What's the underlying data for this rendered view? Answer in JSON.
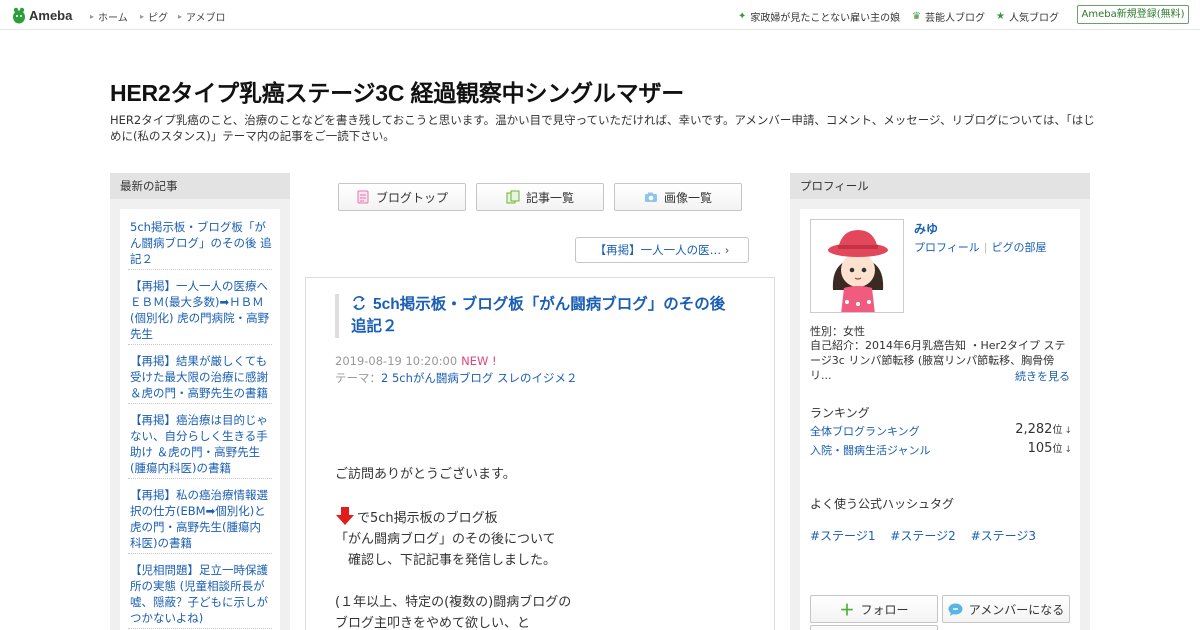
{
  "topbar": {
    "logo_text": "Ameba",
    "nav": [
      "ホーム",
      "ピグ",
      "アメブロ"
    ],
    "right_links": [
      "家政婦が見たことない雇い主の娘",
      "芸能人ブログ",
      "人気ブログ"
    ],
    "register_label": "Ameba新規登録(無料)",
    "accent": "#2c7a2c"
  },
  "blog": {
    "title": "HER2タイプ乳癌ステージ3C 経過観察中シングルマザー",
    "description": "HER2タイプ乳癌のこと、治療のことなどを書き残しておこうと思います。温かい目で見守っていただければ、幸いです。アメンバー申請、コメント、メッセージ、リブログについては、「はじめに(私のスタンス)」テーマ内の記事をご一読下さい。"
  },
  "left": {
    "heading": "最新の記事",
    "items": [
      "5ch掲示板・ブログ板「がん闘病ブログ」のその後 追記２",
      "【再掲】一人一人の医療へ ＥＢＭ(最大多数)➡ＨＢＭ(個別化) 虎の門病院・高野先生",
      "【再掲】結果が厳しくても受けた最大限の治療に感謝 ＆虎の門・高野先生の書籍",
      "【再掲】癌治療は目的じゃない、自分らしく生きる手助け ＆虎の門・高野先生(腫瘍内科医)の書籍",
      "【再掲】私の癌治療情報選択の仕方(EBM➡個別化)と虎の門・高野先生(腫瘍内科医)の書籍",
      "【児相問題】足立一時保護所の実態 (児童相談所長が嘘、隠蔽？子どもに示しがつかないよね)"
    ]
  },
  "center": {
    "buttons": [
      "ブログトップ",
      "記事一覧",
      "画像一覧"
    ],
    "prev_post": "【再掲】一人一人の医…",
    "article": {
      "title": "5ch掲示板・ブログ板「がん闘病ブログ」のその後 追記２",
      "date": "2019-08-19 10:20:00",
      "new_label": "NEW !",
      "theme_label": "テーマ：",
      "theme": "2 5chがん闘病ブログ スレのイジメ２",
      "body": {
        "line1": "ご訪問ありがとうございます。",
        "line2": "で5ch掲示板のブログ板",
        "line3": "「がん闘病ブログ」のその後について",
        "line4": "　確認し、下記記事を発信しました。",
        "line5": "(１年以上、特定の(複数の)闘病ブログの",
        "line6": "ブログ主叩きをやめて欲しい、と"
      }
    }
  },
  "right": {
    "heading": "プロフィール",
    "name": "みゆ",
    "links": [
      "プロフィール",
      "ピグの部屋"
    ],
    "gender": "性別：女性",
    "intro": "自己紹介：2014年6月乳癌告知 ・Her2タイプ ステージ3c リンパ節転移 (腋窩リンパ節転移、胸骨傍リ...",
    "more": "続きを見る",
    "ranking_title": "ランキング",
    "rankings": [
      {
        "label": "全体ブログランキング",
        "value": "2,282",
        "unit": "位",
        "arrow": "↓"
      },
      {
        "label": "入院・闘病生活ジャンル",
        "value": "105",
        "unit": "位",
        "arrow": "↓"
      }
    ],
    "hashtag_title": "よく使う公式ハッシュタグ",
    "hashtags": [
      "#ステージ1",
      "#ステージ2",
      "#ステージ3"
    ],
    "follow_label": "フォロー",
    "amember_label": "アメンバーになる"
  }
}
